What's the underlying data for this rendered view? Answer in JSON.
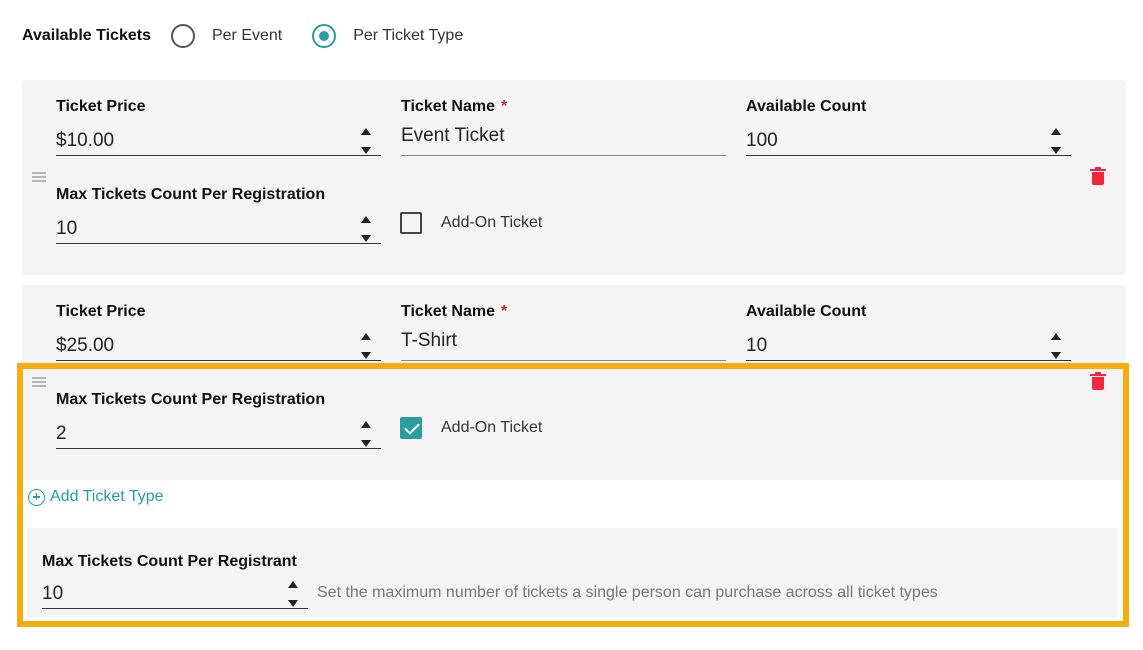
{
  "availability": {
    "title": "Available Tickets",
    "options": [
      {
        "label": "Per Event",
        "selected": false
      },
      {
        "label": "Per Ticket Type",
        "selected": true
      }
    ]
  },
  "ticket_types": [
    {
      "price_label": "Ticket Price",
      "price_value": "$10.00",
      "name_label": "Ticket Name",
      "required_mark": "*",
      "name_value": "Event Ticket",
      "count_label": "Available Count",
      "count_value": "100",
      "max_label": "Max Tickets Count Per Registration",
      "max_value": "10",
      "addon_label": "Add-On Ticket",
      "addon_checked": false
    },
    {
      "price_label": "Ticket Price",
      "price_value": "$25.00",
      "name_label": "Ticket Name",
      "required_mark": "*",
      "name_value": "T-Shirt",
      "count_label": "Available Count",
      "count_value": "10",
      "max_label": "Max Tickets Count Per Registration",
      "max_value": "2",
      "addon_label": "Add-On Ticket",
      "addon_checked": true
    }
  ],
  "add_ticket_type": {
    "label": "Add Ticket Type",
    "icon": "plus-circle-icon"
  },
  "registrant_limit": {
    "label": "Max Tickets Count Per Registrant",
    "value": "10",
    "helper": "Set the maximum number of tickets a single person can purchase across all ticket types"
  },
  "colors": {
    "accent": "#2a9d9f",
    "delete": "#f0283c",
    "highlight": "#f7ad0f",
    "card_bg": "#f4f4f4"
  }
}
